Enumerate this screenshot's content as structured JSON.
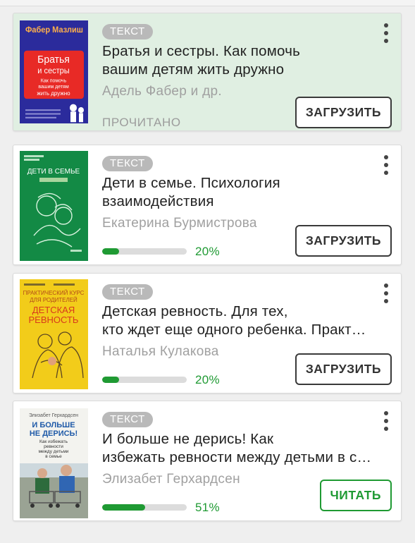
{
  "books": [
    {
      "badge": "ТЕКСТ",
      "title_lines": [
        "Братья и сестры. Как помочь",
        "вашим детям жить дружно"
      ],
      "author": "Адель Фабер и др.",
      "status": "ПРОЧИТАНО",
      "button": "ЗАГРУЗИТЬ",
      "cover": {
        "publisher": "Фабер Мазлиш",
        "title_lines": [
          "Братья",
          "и сестры"
        ],
        "subtitle_lines": [
          "Как помочь",
          "вашим детям",
          "жить дружно"
        ]
      }
    },
    {
      "badge": "ТЕКСТ",
      "title_lines": [
        "Дети в семье. Психология",
        "взаимодействия"
      ],
      "author": "Екатерина Бурмистрова",
      "progress": 20,
      "progress_label": "20%",
      "button": "ЗАГРУЗИТЬ",
      "cover": {
        "title_lines": [
          "ДЕТИ В СЕМЬЕ"
        ]
      }
    },
    {
      "badge": "ТЕКСТ",
      "title_lines": [
        "Детская ревность. Для тех,",
        "кто ждет еще одного ребенка. Практический курс для родителей"
      ],
      "author": "Наталья Кулакова",
      "progress": 20,
      "progress_label": "20%",
      "button": "ЗАГРУЗИТЬ",
      "cover": {
        "top_lines": [
          "ПРАКТИЧЕСКИЙ КУРС",
          "ДЛЯ РОДИТЕЛЕЙ"
        ],
        "title_lines": [
          "ДЕТСКАЯ",
          "РЕВНОСТЬ"
        ]
      }
    },
    {
      "badge": "ТЕКСТ",
      "title_lines": [
        "И больше не дерись! Как",
        "избежать ревности между детьми в семье"
      ],
      "author": "Элизабет Герхардсен",
      "progress": 51,
      "progress_label": "51%",
      "button": "ЧИТАТЬ",
      "cover": {
        "author": "Элизабет Герхардсен",
        "title_lines": [
          "И БОЛЬШЕ",
          "НЕ ДЕРИСЬ!"
        ],
        "subtitle_lines": [
          "Как избежать",
          "ревности",
          "между детьми",
          "в семье"
        ]
      }
    }
  ],
  "colors": {
    "accent": "#1f9a33",
    "read_card": "#e0efe2",
    "badge": "#b9b9b9"
  },
  "icons": {
    "more": "more-vert-icon"
  }
}
